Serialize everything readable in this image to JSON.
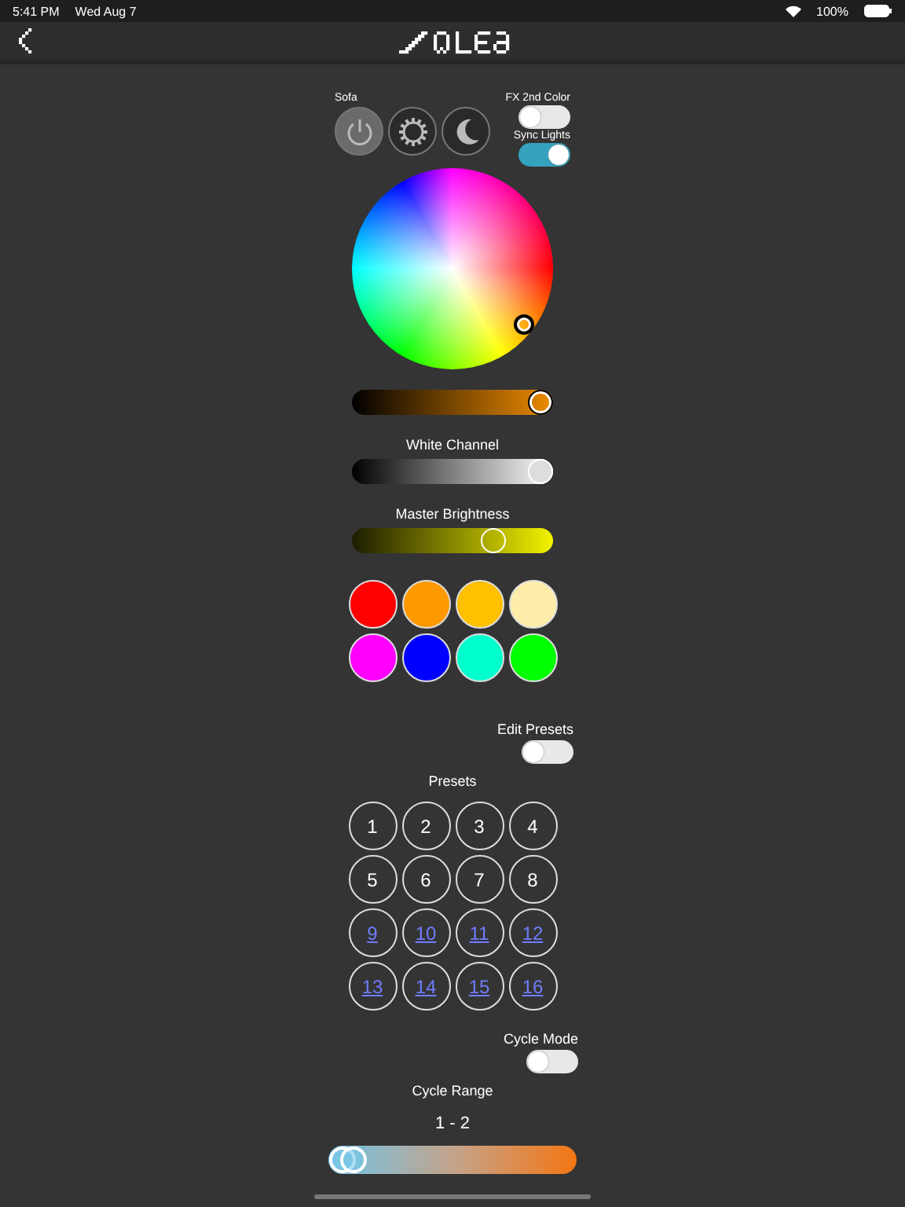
{
  "status_bar": {
    "time": "5:41 PM",
    "date": "Wed Aug 7",
    "battery": "100%"
  },
  "header": {
    "group_label": "Sofa"
  },
  "modes": [
    {
      "kind": "power",
      "selected": true
    },
    {
      "kind": "sun",
      "selected": false
    },
    {
      "kind": "moon",
      "selected": false
    }
  ],
  "toggles_top": [
    {
      "label": "FX 2nd Color",
      "on": false
    },
    {
      "label": "Sync Lights",
      "on": true
    }
  ],
  "sliders": [
    {
      "kind": "hue",
      "level": 1
    },
    {
      "label": "White Channel",
      "kind": "white",
      "level": 1
    },
    {
      "label": "Master Brightness",
      "kind": "master",
      "level": 0.73
    }
  ],
  "swatches": [
    {
      "color": "#ff0000"
    },
    {
      "color": "#ff9900"
    },
    {
      "color": "#ffc000"
    },
    {
      "color": "#ffeeaa"
    },
    {
      "color": "#ff00ff"
    },
    {
      "color": "#0000ff"
    },
    {
      "color": "#00ffcc"
    },
    {
      "color": "#00ff00"
    }
  ],
  "edit_presets": {
    "label": "Edit Presets",
    "on": false
  },
  "presets_title": "Presets",
  "presets": [
    {
      "label": "1",
      "kind": "plain"
    },
    {
      "label": "2",
      "kind": "plain"
    },
    {
      "label": "3",
      "kind": "plain"
    },
    {
      "label": "4",
      "kind": "plain"
    },
    {
      "label": "5",
      "kind": "plain"
    },
    {
      "label": "6",
      "kind": "plain"
    },
    {
      "label": "7",
      "kind": "plain"
    },
    {
      "label": "8",
      "kind": "plain"
    },
    {
      "label": "9",
      "kind": "link"
    },
    {
      "label": "10",
      "kind": "link"
    },
    {
      "label": "11",
      "kind": "link"
    },
    {
      "label": "12",
      "kind": "link"
    },
    {
      "label": "13",
      "kind": "link"
    },
    {
      "label": "14",
      "kind": "link"
    },
    {
      "label": "15",
      "kind": "link"
    },
    {
      "label": "16",
      "kind": "link"
    }
  ],
  "cycle_mode": {
    "label": "Cycle Mode",
    "on": false
  },
  "cycle_range": {
    "label": "Cycle Range",
    "value": "1 - 2",
    "thumbs": [
      {
        "level": 0
      },
      {
        "level": 0.05
      }
    ]
  }
}
